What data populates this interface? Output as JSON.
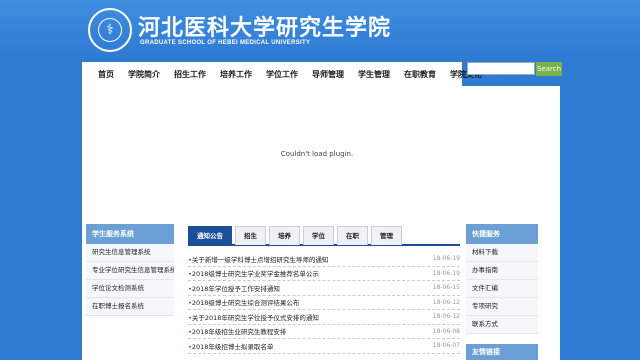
{
  "header": {
    "logo_icon": "caduceus-icon",
    "title_cn": "河北医科大学研究生学院",
    "title_en": "GRADUATE SCHOOL OF HEBEI MEDICAL UNIVERSITY"
  },
  "nav": {
    "items": [
      "首页",
      "学院简介",
      "招生工作",
      "培养工作",
      "学位工作",
      "导师管理",
      "学生管理",
      "在职教育",
      "学院文化"
    ]
  },
  "search": {
    "button_label": "Search",
    "placeholder": ""
  },
  "plugin_message": "Couldn't load plugin.",
  "left_panel": {
    "title": "学生服务系统",
    "items": [
      "研究生信息管理系统",
      "专业学位研究生信息管理系统",
      "学位论文检测系统",
      "在职博士报名系统"
    ]
  },
  "center": {
    "tabs": [
      "通知公告",
      "招生",
      "培养",
      "学位",
      "在职",
      "管理"
    ],
    "news": [
      {
        "title": "关于新增一级学科博士点增招研究生导师的通知",
        "date": "18-06-19"
      },
      {
        "title": "2018级博士研究生学业奖学金推荐名单公示",
        "date": "18-06-19"
      },
      {
        "title": "2018年学位授予工作安排通知",
        "date": "18-06-15"
      },
      {
        "title": "2018级博士研究生综合测评结果公布",
        "date": "18-06-12"
      },
      {
        "title": "关于2018年研究生学位授予仪式安排的通知",
        "date": "18-06-12"
      },
      {
        "title": "2018年级招生业研究生教程安排",
        "date": "18-06-08"
      },
      {
        "title": "2018年级招博士拟录取名单",
        "date": "18-06-07"
      }
    ]
  },
  "right_panel": {
    "title": "快捷服务",
    "items": [
      "材料下载",
      "办事指南",
      "文件汇编",
      "专项研究",
      "联系方式"
    ],
    "title2": "友情链接"
  },
  "colors": {
    "background": "#2f7ad3",
    "tab_active": "#1b4f9a",
    "panel_title": "#6aa0d4",
    "search_button": "#7ab24a"
  }
}
